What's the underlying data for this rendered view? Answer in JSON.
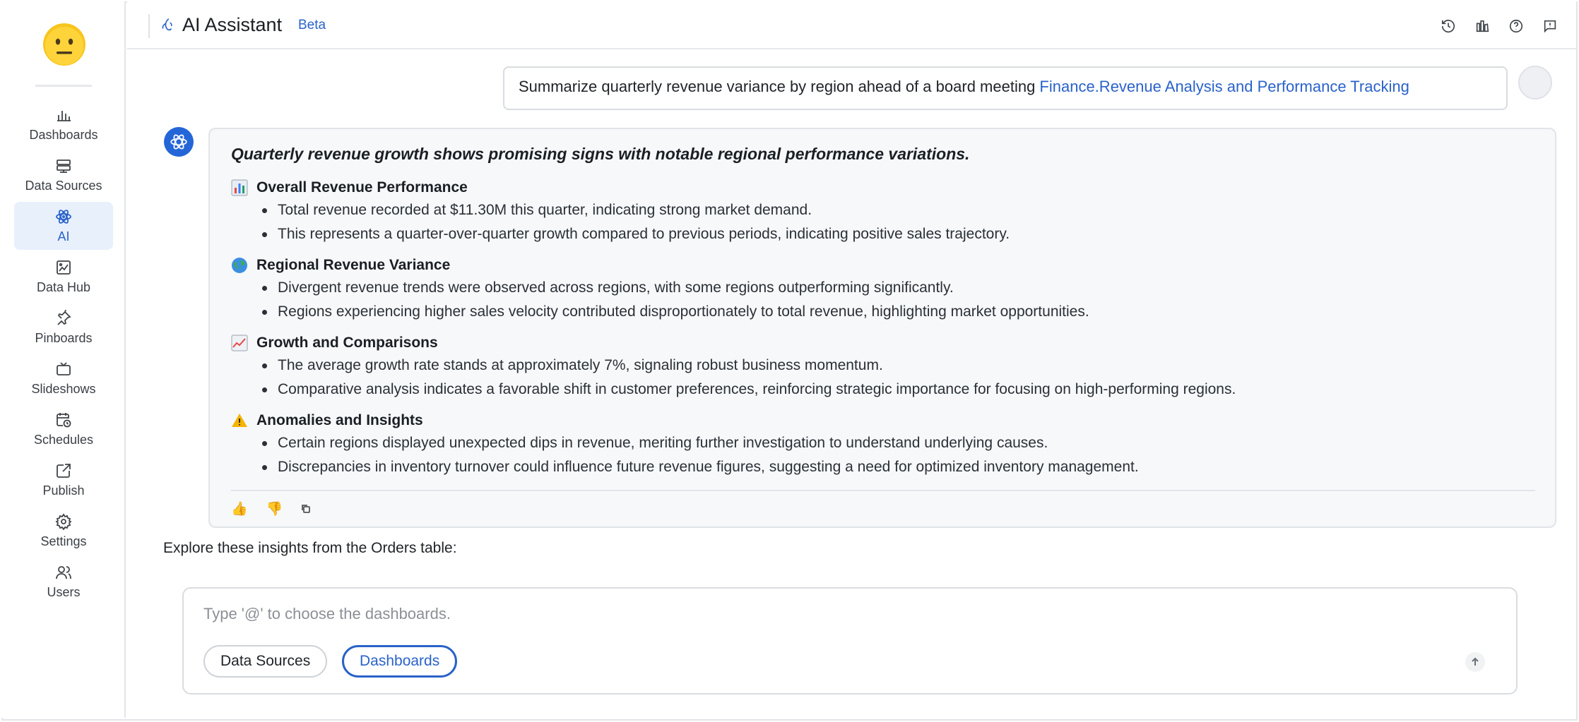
{
  "sidebar": {
    "items": [
      {
        "label": "Dashboards",
        "icon": "bar-chart-icon"
      },
      {
        "label": "Data Sources",
        "icon": "database-icon"
      },
      {
        "label": "AI",
        "icon": "atom-icon",
        "active": true
      },
      {
        "label": "Data Hub",
        "icon": "image-chart-icon"
      },
      {
        "label": "Pinboards",
        "icon": "pin-icon"
      },
      {
        "label": "Slideshows",
        "icon": "tv-icon"
      },
      {
        "label": "Schedules",
        "icon": "calendar-clock-icon"
      },
      {
        "label": "Publish",
        "icon": "share-icon"
      },
      {
        "label": "Settings",
        "icon": "gear-icon"
      },
      {
        "label": "Users",
        "icon": "users-icon"
      }
    ]
  },
  "header": {
    "title": "AI Assistant",
    "badge": "Beta",
    "tools": [
      "history-icon",
      "library-icon",
      "help-icon",
      "feedback-icon"
    ]
  },
  "user_message": {
    "text": "Summarize quarterly revenue variance by region ahead of a board meeting ",
    "reference": "Finance.Revenue Analysis and Performance Tracking"
  },
  "ai_message": {
    "headline": "Quarterly revenue growth shows promising signs with notable regional performance variations.",
    "sections": [
      {
        "emoji": "bar-chart-emoji",
        "title": "Overall Revenue Performance",
        "bullets": [
          "Total revenue recorded at $11.30M this quarter, indicating strong market demand.",
          "This represents a quarter-over-quarter growth compared to previous periods, indicating positive sales trajectory."
        ]
      },
      {
        "emoji": "globe-emoji",
        "title": "Regional Revenue Variance",
        "bullets": [
          "Divergent revenue trends were observed across regions, with some regions outperforming significantly.",
          "Regions experiencing higher sales velocity contributed disproportionately to total revenue, highlighting market opportunities."
        ]
      },
      {
        "emoji": "trending-up-emoji",
        "title": "Growth and Comparisons",
        "bullets": [
          "The average growth rate stands at approximately 7%, signaling robust business momentum.",
          "Comparative analysis indicates a favorable shift in customer preferences, reinforcing strategic importance for focusing on high-performing regions."
        ]
      },
      {
        "emoji": "warning-emoji",
        "title": "Anomalies and Insights",
        "bullets": [
          "Certain regions displayed unexpected dips in revenue, meriting further investigation to understand underlying causes.",
          "Discrepancies in inventory turnover could influence future revenue figures, suggesting a need for optimized inventory management."
        ]
      }
    ],
    "actions": {
      "like": "👍",
      "dislike": "👎"
    }
  },
  "explore_text": "Explore these insights from the Orders table:",
  "composer": {
    "placeholder": "Type '@' to choose the dashboards.",
    "chips": [
      "Data Sources",
      "Dashboards"
    ]
  },
  "colors": {
    "accent": "#2a62c9",
    "ai_avatar": "#2466d8",
    "active_bg": "#e8f0fc"
  }
}
